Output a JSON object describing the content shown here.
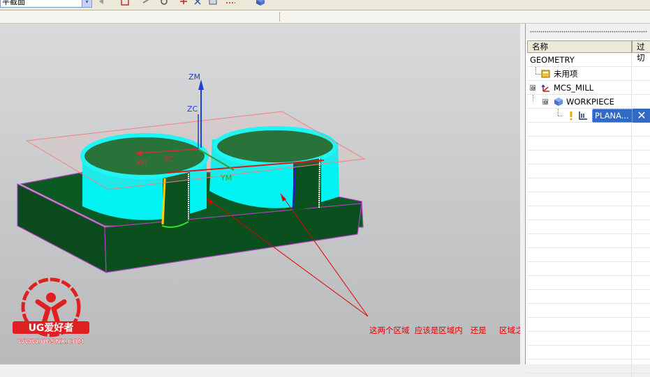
{
  "toolbar": {
    "view_combo_value": "平截面",
    "combo_arrow": "▾"
  },
  "viewport": {
    "axis_labels": {
      "zm": "ZM",
      "zc": "ZC",
      "xm": "XM",
      "xc": "XC",
      "ym": "YM"
    },
    "annotation": "这两个区域  应该是区域内   还是     区域之间  呢"
  },
  "watermark": {
    "brand": "UG爱好者",
    "url": "WWW.UGSNX.COM"
  },
  "navigator": {
    "columns": [
      "名称",
      "过切"
    ],
    "nodes": [
      {
        "label": "GEOMETRY",
        "icon": "none"
      },
      {
        "label": "未用项",
        "icon": "unused-items-icon"
      },
      {
        "label": "MCS_MILL",
        "icon": "mcs-icon",
        "expander": "⊖"
      },
      {
        "label": "WORKPIECE",
        "icon": "workpiece-icon",
        "expander": "⊖"
      },
      {
        "label": "PLANA...",
        "icon": "operation-icon",
        "selected": true,
        "status": "✕"
      }
    ]
  },
  "colors": {
    "block_green": "#0b4d1f",
    "boss_cyan": "#00ffff",
    "selection_blue": "#316ac5",
    "annotation_red": "#e00000",
    "plane_pink": "#f08080"
  }
}
